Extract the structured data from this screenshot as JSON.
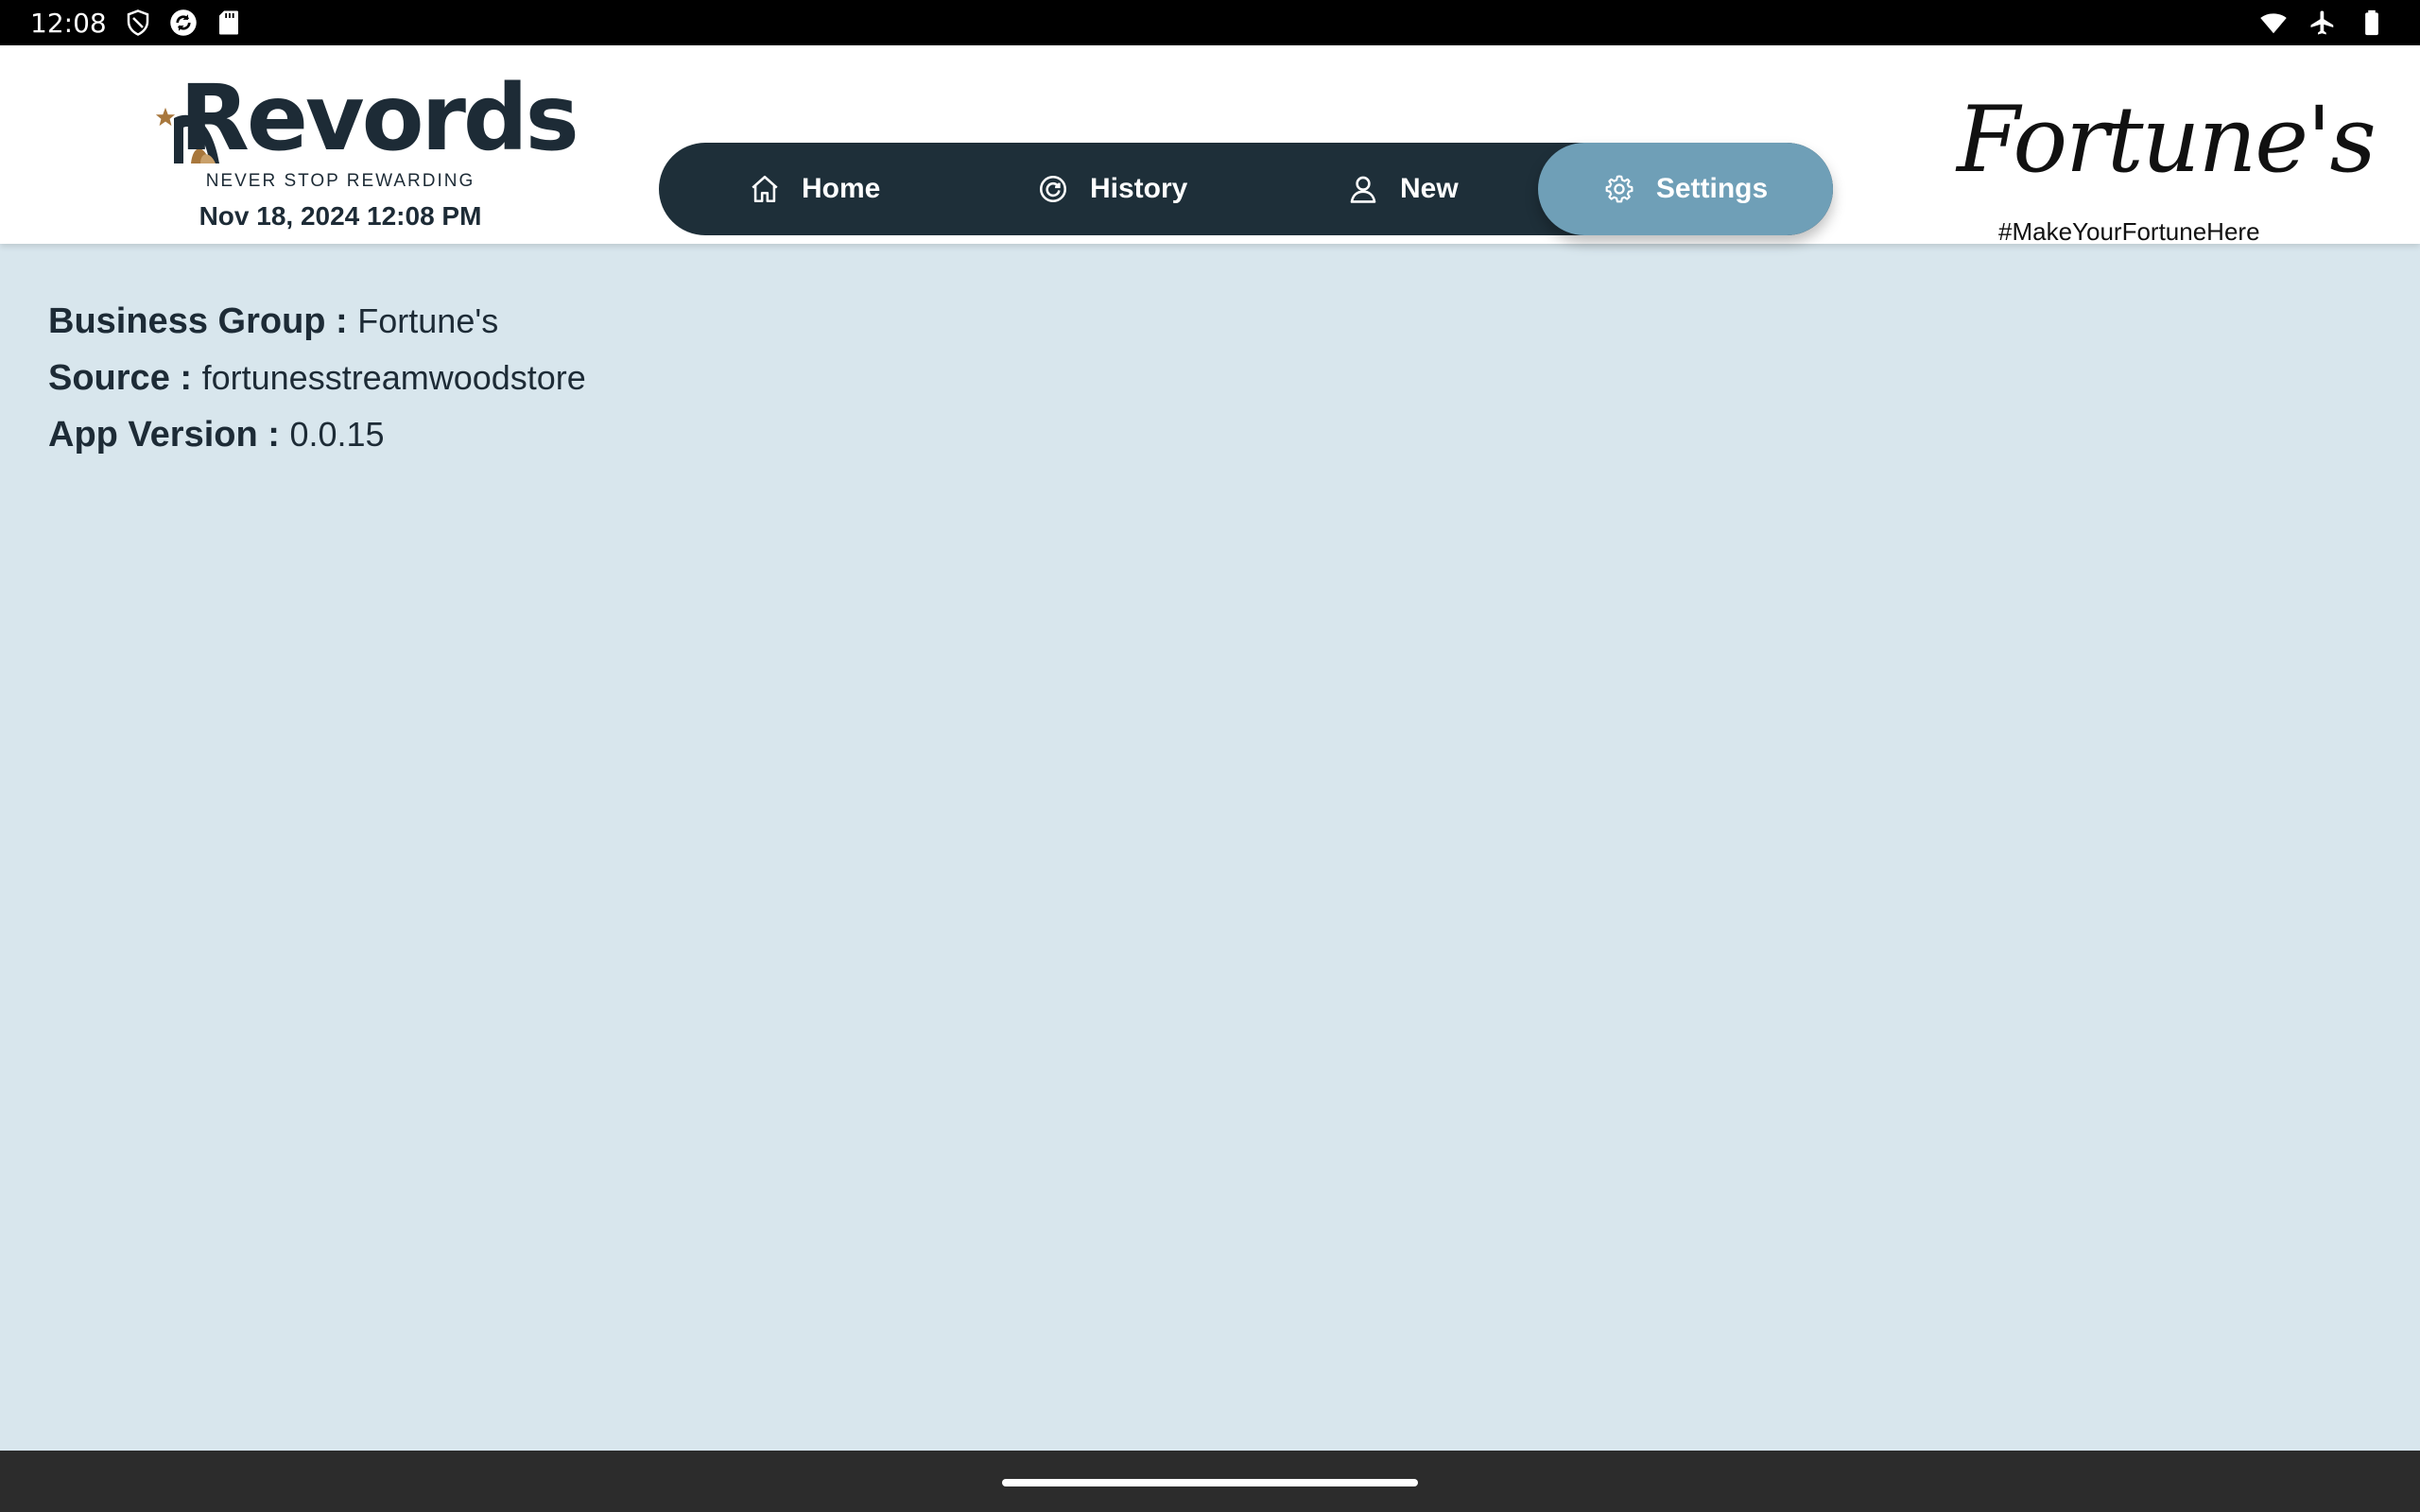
{
  "status_bar": {
    "time": "12:08",
    "icons": [
      "shield-icon",
      "sync-icon",
      "sd-card-icon",
      "wifi-icon",
      "airplane-icon",
      "battery-icon"
    ]
  },
  "header": {
    "brand": {
      "name": "Revords",
      "tagline": "NEVER STOP REWARDING",
      "datetime": "Nov 18, 2024 12:08 PM",
      "colors": {
        "dark": "#1d2b36",
        "gold": "#a8773c"
      }
    },
    "nav": {
      "items": [
        {
          "label": "Home",
          "icon": "home-icon"
        },
        {
          "label": "History",
          "icon": "history-icon"
        },
        {
          "label": "New",
          "icon": "user-icon"
        },
        {
          "label": "Settings",
          "icon": "gear-icon",
          "active": true
        }
      ],
      "colors": {
        "bar": "#1e2f39",
        "active": "#6f9fb7"
      }
    },
    "partner": {
      "name": "Fortune's",
      "tagline": "#MakeYourFortuneHere"
    }
  },
  "main": {
    "info": [
      {
        "label": "Business Group :",
        "value": "Fortune's"
      },
      {
        "label": "Source :",
        "value": "fortunesstreamwoodstore"
      },
      {
        "label": "App Version :",
        "value": "0.0.15"
      }
    ],
    "background": "#d8e6ed"
  }
}
